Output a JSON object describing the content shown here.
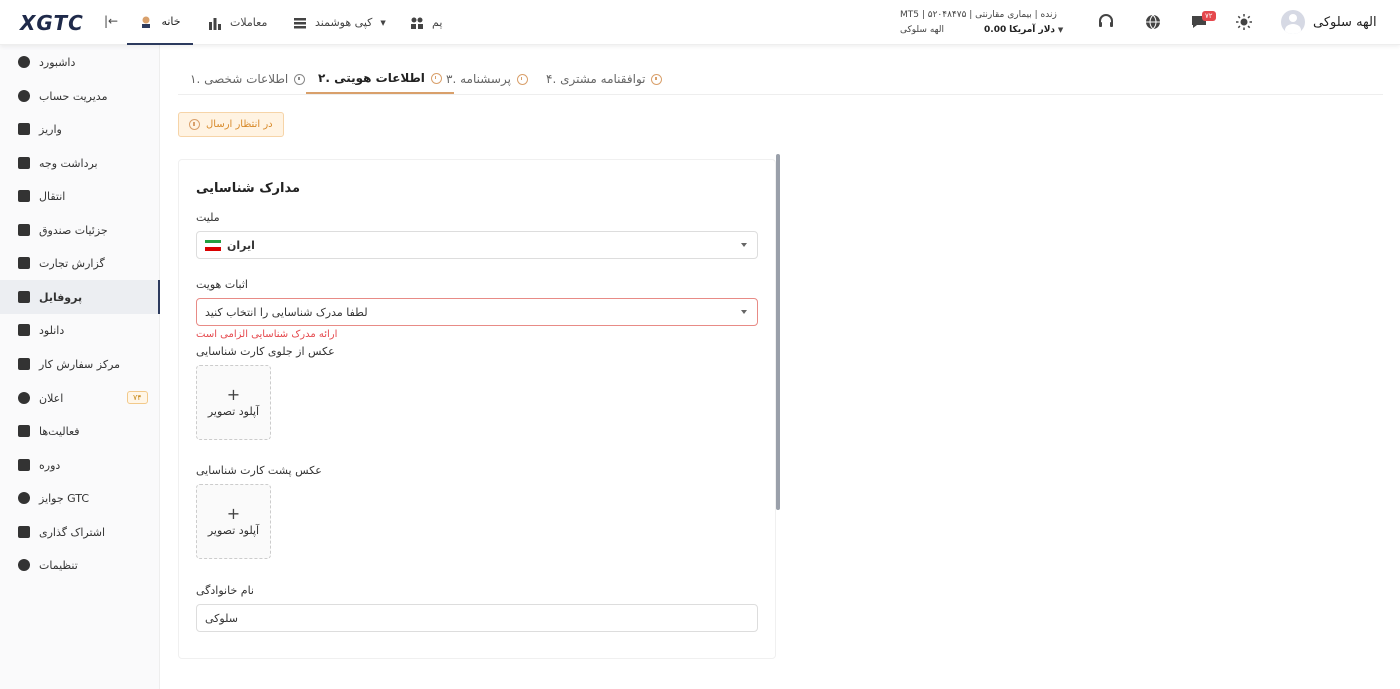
{
  "header": {
    "logo": "XGTC",
    "nav": [
      {
        "label": "خانه"
      },
      {
        "label": "معاملات"
      },
      {
        "label": "کپی هوشمند"
      },
      {
        "label": "پم"
      }
    ],
    "account": {
      "line1": "MT5 | زنده | بیماری مقارنتی | ۵۲۰۴۸۴۷۵",
      "name": "الهه سلوکی",
      "balance": "0.00",
      "currency": "دلار آمریکا"
    },
    "notification_count": "۷۲",
    "user_name": "الهه سلوکی"
  },
  "sidebar": {
    "items": [
      {
        "label": "داشبورد"
      },
      {
        "label": "مدیریت حساب"
      },
      {
        "label": "واریز"
      },
      {
        "label": "برداشت وجه"
      },
      {
        "label": "انتقال"
      },
      {
        "label": "جزئیات صندوق"
      },
      {
        "label": "گزارش تجارت"
      },
      {
        "label": "پروفایل"
      },
      {
        "label": "دانلود"
      },
      {
        "label": "مرکز سفارش کار"
      },
      {
        "label": "اعلان",
        "badge": "۷۴"
      },
      {
        "label": "فعالیت‌ها"
      },
      {
        "label": "دوره"
      },
      {
        "label": "جوایز GTC"
      },
      {
        "label": "اشتراک گذاری"
      },
      {
        "label": "تنظیمات"
      }
    ]
  },
  "tabs": [
    {
      "label": "۱. اطلاعات شخصی"
    },
    {
      "label": "۲. اطلاعات هویتی"
    },
    {
      "label": "۳. پرسشنامه"
    },
    {
      "label": "۴. توافقنامه مشتری"
    }
  ],
  "status": "در انتظار ارسال",
  "form": {
    "title": "مدارک شناسایی",
    "nationality_label": "ملیت",
    "nationality_value": "ایران",
    "id_label": "اثبات هویت",
    "id_placeholder": "لطفا مدرک شناسایی را انتخاب کنید",
    "id_error": "ارائه مدرک شناسایی الزامی است",
    "front_label": "عکس از جلوی کارت شناسایی",
    "back_label": "عکس پشت کارت شناسایی",
    "upload_label": "آپلود تصویر",
    "lastname_label": "نام خانوادگی",
    "lastname_value": "سلوکی"
  }
}
